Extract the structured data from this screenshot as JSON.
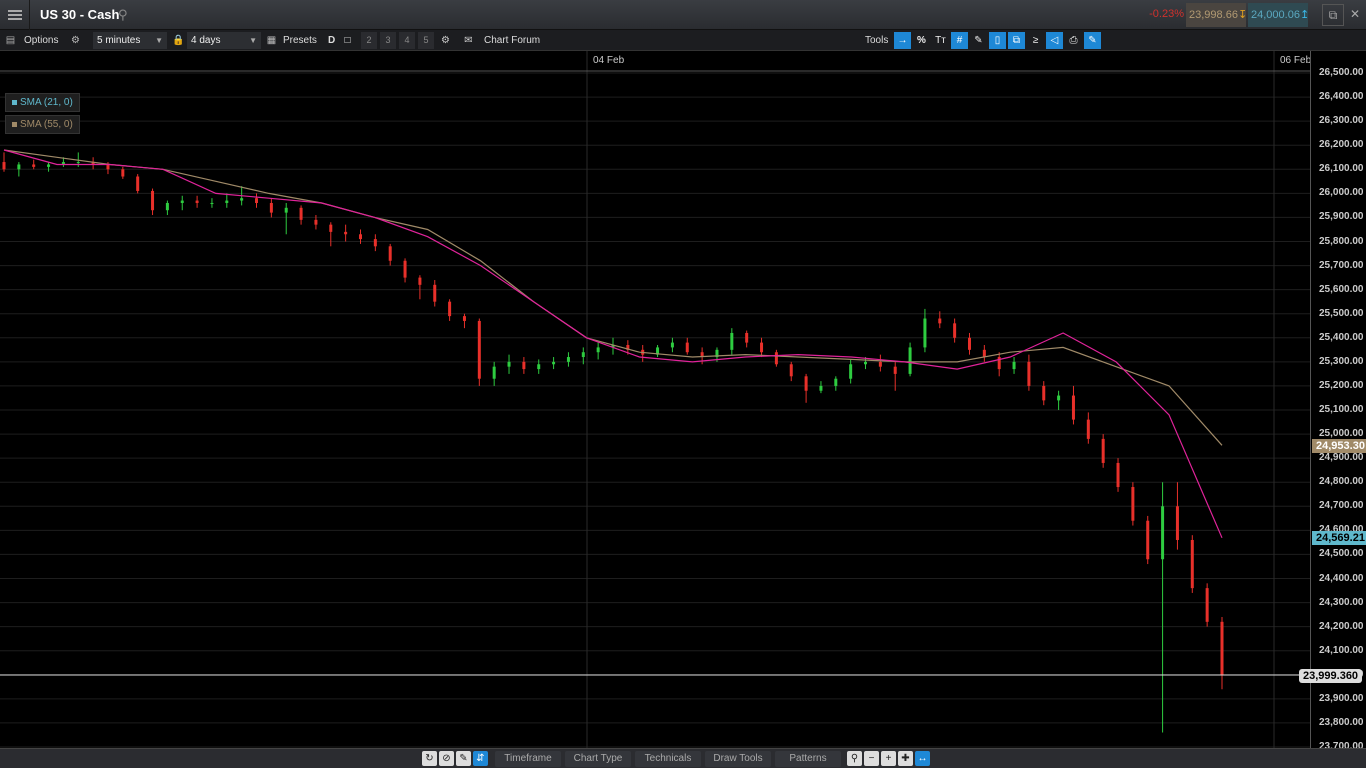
{
  "header": {
    "title": "US 30 - Cash",
    "change": "-0.23%",
    "sell_price": "23,998.66",
    "buy_price": "24,000.06"
  },
  "toolbar": {
    "options_label": "Options",
    "interval": "5 minutes",
    "range": "4 days",
    "presets_label": "Presets",
    "d_label": "D",
    "numbers": [
      "2",
      "3",
      "4",
      "5"
    ],
    "chart_forum_label": "Chart Forum",
    "tools_label": "Tools",
    "percent_label": "%",
    "text_tool_label": "Tт"
  },
  "chart": {
    "date_labels": [
      "04 Feb",
      "06 Feb"
    ],
    "legend": [
      {
        "label": "SMA (21, 0)",
        "color": "#5fb8cc"
      },
      {
        "label": "SMA (55, 0)",
        "color": "#a08a68"
      }
    ],
    "price_ticks": [
      "26,500.00",
      "26,400.00",
      "26,300.00",
      "26,200.00",
      "26,100.00",
      "26,000.00",
      "25,900.00",
      "25,800.00",
      "25,700.00",
      "25,600.00",
      "25,500.00",
      "25,400.00",
      "25,300.00",
      "25,200.00",
      "25,100.00",
      "25,000.00",
      "24,900.00",
      "24,800.00",
      "24,700.00",
      "24,600.00",
      "24,500.00",
      "24,400.00",
      "24,300.00",
      "24,200.00",
      "24,100.00",
      "24,000.00",
      "23,900.00",
      "23,800.00",
      "23,700.00"
    ],
    "sma55_tag": "24,953.30",
    "sma21_tag": "24,569.21",
    "current_price": "23,999.360",
    "colors": {
      "up": "#2ecc40",
      "down": "#e8302a",
      "sma21": "#5fb8cc",
      "sma55": "#a08a68",
      "sma_pink": "#e0239a"
    }
  },
  "bottom": {
    "tabs": [
      "Timeframe",
      "Chart Type",
      "Technicals",
      "Draw Tools",
      "Patterns"
    ]
  },
  "chart_data": {
    "type": "candlestick",
    "instrument": "US 30 - Cash",
    "interval": "5 minutes",
    "range": "4 days",
    "y_range": [
      23700,
      26500
    ],
    "x_labels": [
      "04 Feb",
      "06 Feb"
    ],
    "series": [
      {
        "name": "SMA (21, 0)",
        "points": [
          26180,
          26120,
          26120,
          26100,
          26000,
          25980,
          25960,
          25900,
          25820,
          25700,
          25550,
          25400,
          25320,
          25300,
          25320,
          25330,
          25320,
          25300,
          25270,
          25320,
          25420,
          25300,
          25080,
          24569.21
        ]
      },
      {
        "name": "SMA (55, 0)",
        "points": [
          26180,
          26150,
          26120,
          26100,
          26050,
          26000,
          25960,
          25900,
          25850,
          25720,
          25550,
          25400,
          25340,
          25320,
          25330,
          25320,
          25310,
          25300,
          25300,
          25340,
          25360,
          25280,
          25200,
          24953.3
        ]
      }
    ],
    "candles": [
      [
        26130,
        26170,
        26090,
        26100
      ],
      [
        26100,
        26130,
        26070,
        26120
      ],
      [
        26120,
        26140,
        26100,
        26110
      ],
      [
        26110,
        26130,
        26090,
        26120
      ],
      [
        26120,
        26150,
        26110,
        26130
      ],
      [
        26130,
        26170,
        26110,
        26130
      ],
      [
        26130,
        26150,
        26100,
        26120
      ],
      [
        26120,
        26130,
        26080,
        26100
      ],
      [
        26100,
        26110,
        26060,
        26070
      ],
      [
        26070,
        26080,
        26000,
        26010
      ],
      [
        26010,
        26020,
        25910,
        25930
      ],
      [
        25930,
        25970,
        25910,
        25960
      ],
      [
        25960,
        25990,
        25930,
        25970
      ],
      [
        25970,
        25990,
        25940,
        25960
      ],
      [
        25960,
        25980,
        25940,
        25960
      ],
      [
        25960,
        26000,
        25940,
        25970
      ],
      [
        25970,
        26030,
        25950,
        25980
      ],
      [
        25980,
        26000,
        25940,
        25960
      ],
      [
        25960,
        25980,
        25900,
        25920
      ],
      [
        25920,
        25960,
        25830,
        25940
      ],
      [
        25940,
        25950,
        25870,
        25890
      ],
      [
        25890,
        25910,
        25850,
        25870
      ],
      [
        25870,
        25880,
        25780,
        25840
      ],
      [
        25840,
        25870,
        25800,
        25830
      ],
      [
        25830,
        25850,
        25790,
        25810
      ],
      [
        25810,
        25830,
        25760,
        25780
      ],
      [
        25780,
        25790,
        25700,
        25720
      ],
      [
        25720,
        25730,
        25630,
        25650
      ],
      [
        25650,
        25660,
        25560,
        25620
      ],
      [
        25620,
        25640,
        25530,
        25550
      ],
      [
        25550,
        25560,
        25470,
        25490
      ],
      [
        25490,
        25500,
        25440,
        25470
      ],
      [
        25470,
        25480,
        25200,
        25230
      ],
      [
        25230,
        25300,
        25200,
        25280
      ],
      [
        25280,
        25330,
        25250,
        25300
      ],
      [
        25300,
        25320,
        25250,
        25270
      ],
      [
        25270,
        25310,
        25250,
        25290
      ],
      [
        25290,
        25320,
        25270,
        25300
      ],
      [
        25300,
        25340,
        25280,
        25320
      ],
      [
        25320,
        25360,
        25290,
        25340
      ],
      [
        25340,
        25380,
        25310,
        25360
      ],
      [
        25360,
        25400,
        25330,
        25370
      ],
      [
        25370,
        25390,
        25330,
        25350
      ],
      [
        25350,
        25370,
        25300,
        25330
      ],
      [
        25330,
        25370,
        25320,
        25360
      ],
      [
        25360,
        25400,
        25340,
        25380
      ],
      [
        25380,
        25400,
        25330,
        25340
      ],
      [
        25340,
        25360,
        25290,
        25320
      ],
      [
        25320,
        25360,
        25300,
        25350
      ],
      [
        25350,
        25440,
        25330,
        25420
      ],
      [
        25420,
        25430,
        25360,
        25380
      ],
      [
        25380,
        25400,
        25320,
        25340
      ],
      [
        25340,
        25350,
        25280,
        25290
      ],
      [
        25290,
        25300,
        25220,
        25240
      ],
      [
        25240,
        25250,
        25130,
        25180
      ],
      [
        25180,
        25220,
        25170,
        25200
      ],
      [
        25200,
        25240,
        25180,
        25230
      ],
      [
        25230,
        25310,
        25210,
        25290
      ],
      [
        25290,
        25320,
        25270,
        25300
      ],
      [
        25300,
        25330,
        25260,
        25280
      ],
      [
        25280,
        25300,
        25180,
        25250
      ],
      [
        25250,
        25380,
        25240,
        25360
      ],
      [
        25360,
        25520,
        25340,
        25480
      ],
      [
        25480,
        25510,
        25440,
        25460
      ],
      [
        25460,
        25480,
        25380,
        25400
      ],
      [
        25400,
        25420,
        25330,
        25350
      ],
      [
        25350,
        25370,
        25300,
        25320
      ],
      [
        25320,
        25340,
        25240,
        25270
      ],
      [
        25270,
        25320,
        25250,
        25300
      ],
      [
        25300,
        25330,
        25180,
        25200
      ],
      [
        25200,
        25220,
        25120,
        25140
      ],
      [
        25140,
        25180,
        25100,
        25160
      ],
      [
        25160,
        25200,
        25040,
        25060
      ],
      [
        25060,
        25090,
        24960,
        24980
      ],
      [
        24980,
        25000,
        24860,
        24880
      ],
      [
        24880,
        24900,
        24760,
        24780
      ],
      [
        24780,
        24800,
        24620,
        24640
      ],
      [
        24640,
        24660,
        24460,
        24480
      ],
      [
        24480,
        24800,
        23760,
        24700
      ],
      [
        24700,
        24800,
        24520,
        24560
      ],
      [
        24560,
        24580,
        24340,
        24360
      ],
      [
        24360,
        24380,
        24200,
        24220
      ],
      [
        24220,
        24240,
        23940,
        23999
      ]
    ]
  }
}
